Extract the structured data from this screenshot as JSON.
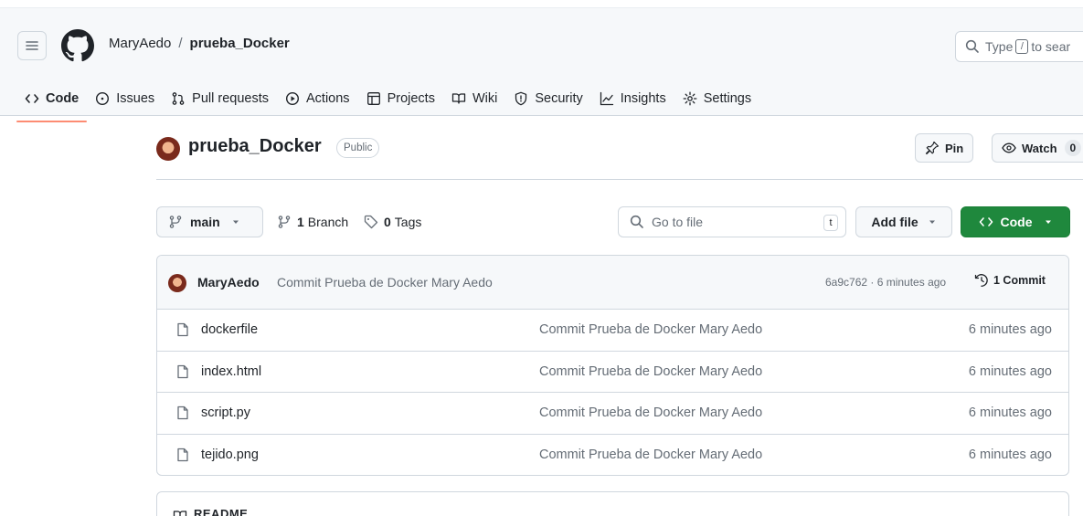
{
  "header": {
    "owner": "MaryAedo",
    "separator": "/",
    "repo": "prueba_Docker",
    "search_prefix": "Type",
    "search_key": "/",
    "search_suffix": "to sear"
  },
  "nav": {
    "items": [
      {
        "label": "Code",
        "icon": "code-icon",
        "active": true
      },
      {
        "label": "Issues",
        "icon": "issue-icon"
      },
      {
        "label": "Pull requests",
        "icon": "pull-request-icon"
      },
      {
        "label": "Actions",
        "icon": "play-icon"
      },
      {
        "label": "Projects",
        "icon": "table-icon"
      },
      {
        "label": "Wiki",
        "icon": "book-icon"
      },
      {
        "label": "Security",
        "icon": "shield-icon"
      },
      {
        "label": "Insights",
        "icon": "graph-icon"
      },
      {
        "label": "Settings",
        "icon": "gear-icon"
      }
    ]
  },
  "repo": {
    "title": "prueba_Docker",
    "visibility": "Public",
    "pin_label": "Pin",
    "watch_label": "Watch",
    "watch_count": "0"
  },
  "toolbar": {
    "branch": "main",
    "branch_count": "1",
    "branch_label": "Branch",
    "tag_count": "0",
    "tag_label": "Tags",
    "goto_placeholder": "Go to file",
    "goto_key": "t",
    "add_file_label": "Add file",
    "code_label": "Code"
  },
  "latest_commit": {
    "author": "MaryAedo",
    "message": "Commit Prueba de Docker Mary Aedo",
    "sha_time": "6a9c762 · 6 minutes ago",
    "commit_count_label": "1 Commit"
  },
  "files": [
    {
      "name": "dockerfile",
      "message": "Commit Prueba de Docker Mary Aedo",
      "date": "6 minutes ago"
    },
    {
      "name": "index.html",
      "message": "Commit Prueba de Docker Mary Aedo",
      "date": "6 minutes ago"
    },
    {
      "name": "script.py",
      "message": "Commit Prueba de Docker Mary Aedo",
      "date": "6 minutes ago"
    },
    {
      "name": "tejido.png",
      "message": "Commit Prueba de Docker Mary Aedo",
      "date": "6 minutes ago"
    }
  ],
  "readme": {
    "label": "README"
  }
}
